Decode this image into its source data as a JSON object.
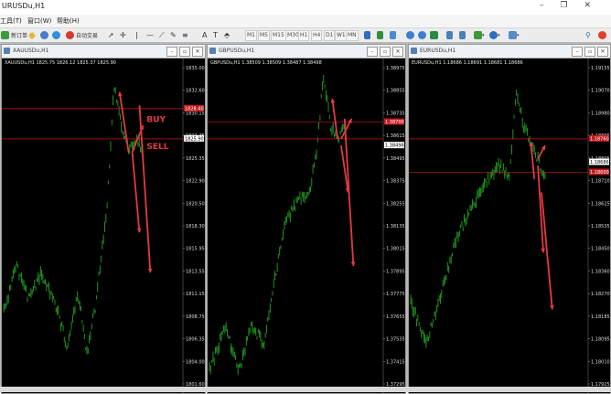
{
  "app": {
    "title": "URUSDu,H1"
  },
  "menu": [
    "工具(T)",
    "窗口(W)",
    "帮助(H)"
  ],
  "toolbar": {
    "new_order": "新订单",
    "auto_trade": "自动交易",
    "timeframes": [
      "M1",
      "M5",
      "M15",
      "M30",
      "H1",
      "H4",
      "D1",
      "W1",
      "MN"
    ]
  },
  "icons": {
    "toolbar": [
      "new-order-icon",
      "diamond-icon",
      "user-icon",
      "globe-icon",
      "auto-trade-icon",
      "cursor-icon",
      "crosshair-icon",
      "vline-icon",
      "trendline-icon",
      "pencil-icon",
      "hline-icon",
      "text-icon",
      "label-icon",
      "shapes-icon",
      "chart-bar-icon",
      "chart-candle-icon",
      "chart-line-icon",
      "zoom-in-icon",
      "zoom-out-icon",
      "tile-icon",
      "autoscroll-icon",
      "shift-icon",
      "indicators-icon",
      "period-icon",
      "templates-icon",
      "search-icon",
      "alert-icon"
    ]
  },
  "colors": {
    "chart_bg": "#000000",
    "bars": "#22a322",
    "level_line": "#c8191e",
    "arrow": "#e53a40",
    "axis_text": "#dcdcdc"
  },
  "charts": [
    {
      "window_title": "XAUUSDu,H1",
      "symbol_label": "XAUUSDu,H1",
      "ohlc": "XAUUSDu,H1  1825.75 1826.12 1825.37 1825.90",
      "ticks": [
        "1835.00",
        "1832.60",
        "1830.15",
        "1827.75",
        "1825.35",
        "1822.90",
        "1820.50",
        "1818.30",
        "1815.95",
        "1813.55",
        "1811.15",
        "1808.75",
        "1806.35",
        "1804.00",
        "1801.60"
      ],
      "price_tags": [
        "1828.40",
        "1825.90"
      ],
      "annotations": [
        "BUY",
        "SELL"
      ]
    },
    {
      "window_title": "GBPUSDu,H1",
      "symbol_label": "GBPUSDu,H1",
      "ohlc": "GBPUSDu,H1  1.38509 1.38509 1.38487 1.38498",
      "ticks": [
        "1.38975",
        "1.38855",
        "1.38735",
        "1.38615",
        "1.38495",
        "1.38375",
        "1.38255",
        "1.38135",
        "1.38015",
        "1.37895",
        "1.37775",
        "1.37655",
        "1.37535",
        "1.37415",
        "1.37295"
      ],
      "price_tags": [
        "1.38700",
        "1.38498"
      ],
      "annotations": []
    },
    {
      "window_title": "EURUSDu,H1",
      "symbol_label": "EURUSDu,H1",
      "ohlc": "EURUSDu,H1  1.18686 1.18691 1.18681 1.18686",
      "ticks": [
        "1.19155",
        "1.19070",
        "1.18980",
        "1.18895",
        "1.18805",
        "1.18710",
        "1.18625",
        "1.18535",
        "1.18450",
        "1.18360",
        "1.18270",
        "1.18185",
        "1.18095",
        "1.18010",
        "1.17925"
      ],
      "price_tags": [
        "1.18760",
        "1.18686",
        "1.18600"
      ],
      "annotations": []
    }
  ]
}
